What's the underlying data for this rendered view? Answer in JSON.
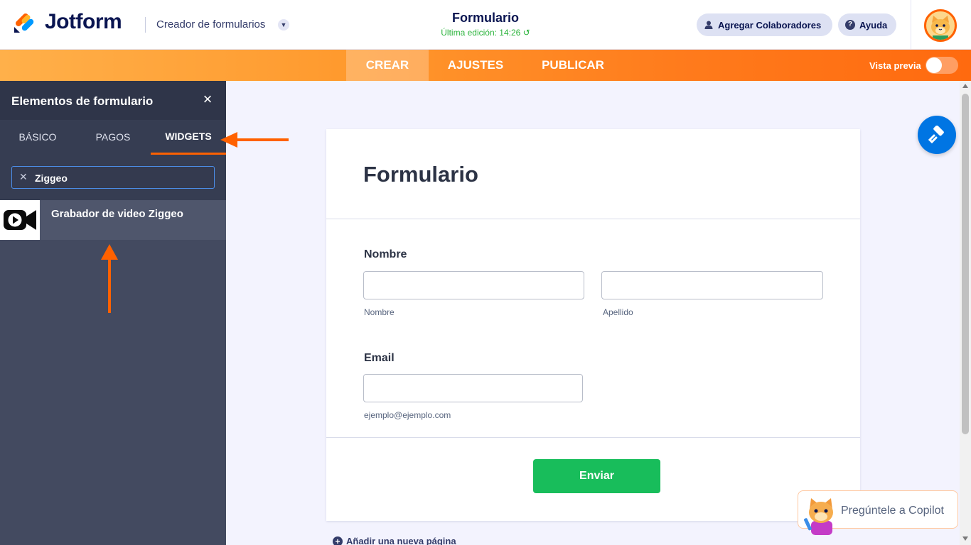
{
  "header": {
    "brand": "Jotform",
    "builder_label": "Creador de formularios",
    "form_title": "Formulario",
    "last_edit": "Última edición: 14:26",
    "collaborators_button": "Agregar Colaboradores",
    "help_button": "Ayuda"
  },
  "navbar": {
    "tabs": [
      {
        "label": "CREAR",
        "active": true
      },
      {
        "label": "AJUSTES",
        "active": false
      },
      {
        "label": "PUBLICAR",
        "active": false
      }
    ],
    "preview_label": "Vista previa",
    "preview_enabled": false
  },
  "sidebar": {
    "title": "Elementos de formulario",
    "tabs": [
      {
        "label": "BÁSICO",
        "active": false
      },
      {
        "label": "PAGOS",
        "active": false
      },
      {
        "label": "WIDGETS",
        "active": true
      }
    ],
    "search": {
      "value": "Ziggeo"
    },
    "results": [
      {
        "name": "Grabador de video Ziggeo",
        "icon": "video-camera-icon"
      }
    ]
  },
  "form": {
    "title": "Formulario",
    "name_label": "Nombre",
    "first_name_sublabel": "Nombre",
    "last_name_sublabel": "Apellido",
    "email_label": "Email",
    "email_sublabel": "ejemplo@ejemplo.com",
    "submit_label": "Enviar"
  },
  "add_page": "Añadir una nueva página",
  "copilot": {
    "label": "Pregúntele a Copilot"
  },
  "colors": {
    "brand_orange": "#ff6100",
    "submit_green": "#18bd5b",
    "designer_blue": "#0075e3",
    "sidebar_bg": "#434a60"
  }
}
